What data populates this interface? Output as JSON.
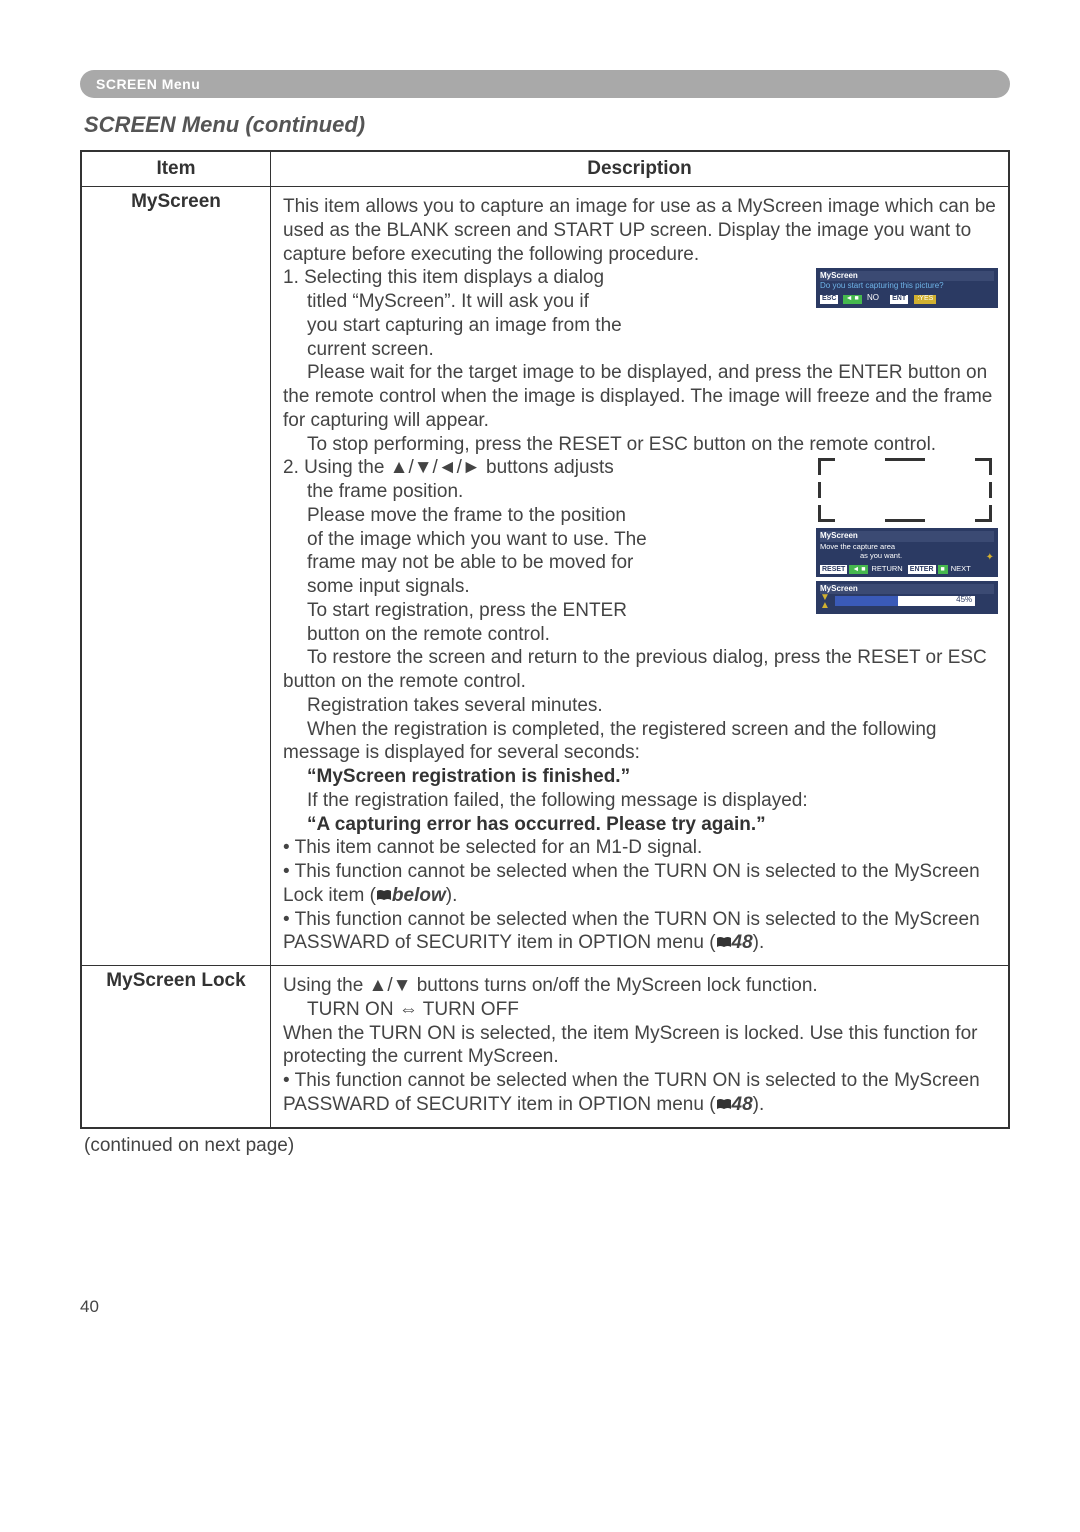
{
  "header": {
    "pill": "SCREEN Menu"
  },
  "title": "SCREEN Menu (continued)",
  "table": {
    "headers": {
      "item": "Item",
      "desc": "Description"
    },
    "rows": [
      {
        "item": "MyScreen",
        "intro": "This item allows you to capture an image for use as a MyScreen image which can be used as the BLANK screen and START UP screen. Display the image you want to capture before executing the following procedure.",
        "step1a": "1. Selecting this item displays a dialog",
        "step1b": "titled “MyScreen”. It will ask you if",
        "step1c": "you start capturing an image from the",
        "step1d": "current screen.",
        "step1e": "Please wait for the target image to be displayed, and press the ENTER button on the remote control when the image is displayed. The image will freeze and the frame for capturing will appear.",
        "step1f": "To stop performing, press the RESET or ESC button on the remote control.",
        "step2a": "2. Using the ▲/▼/◄/► buttons adjusts",
        "step2b": "the frame position.",
        "step2c": "Please move the frame to the position",
        "step2d": "of the image which you want to use. The",
        "step2e": "frame may not be able to be moved for",
        "step2f": "some input signals.",
        "step2g": "To start registration, press the ENTER",
        "step2h": "button on the remote control.",
        "step2i": "To restore the screen and return to the previous dialog, press the RESET or ESC button on the remote control.",
        "reg": "Registration takes several minutes.",
        "done1": "When the registration is completed, the registered screen and the following message is displayed for several seconds:",
        "done2": "“MyScreen registration is finished.”",
        "fail1": "If the registration failed, the following message is displayed:",
        "fail2": "“A capturing error has occurred. Please try again.”",
        "bul1": "• This item cannot be selected for an M1-D signal.",
        "bul2": "• This function cannot be selected when the TURN ON is selected to the MyScreen Lock item (",
        "bul2ref": "below",
        "bul2end": ").",
        "bul3": "• This function cannot be selected when the TURN ON is selected to the MyScreen PASSWARD of SECURITY item in OPTION menu (",
        "bul3ref": "48",
        "bul3end": ").",
        "fig1": {
          "title": "MyScreen",
          "q": "Do you start capturing this picture?",
          "esc": "ESC",
          "no": "NO",
          "ent": "ENT",
          "yes": "YES"
        },
        "fig2": {
          "title": "MyScreen",
          "l1": "Move the capture area",
          "l2": "as you want.",
          "reset": "RESET",
          "return": "RETURN",
          "enter": "ENTER",
          "next": "NEXT"
        },
        "fig3": {
          "title": "MyScreen",
          "pct": "45%"
        }
      },
      {
        "item": "MyScreen Lock",
        "l1": "Using the ▲/▼ buttons turns on/off the MyScreen lock function.",
        "l2": "TURN ON ⇔ TURN OFF",
        "l3": "When the TURN ON is selected, the item MyScreen is locked. Use this function for protecting the current MyScreen.",
        "l4": "• This function cannot be selected when the TURN ON is selected to the MyScreen PASSWARD of SECURITY item in OPTION menu (",
        "l4ref": "48",
        "l4end": ")."
      }
    ]
  },
  "cont": "(continued on next page)",
  "pagenum": "40"
}
